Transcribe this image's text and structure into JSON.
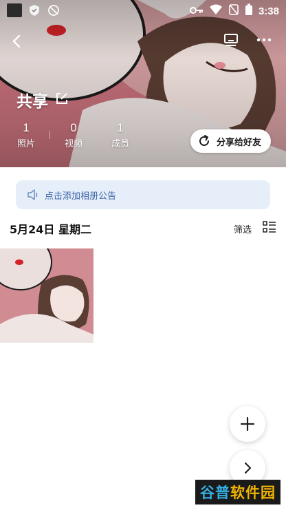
{
  "status_bar": {
    "time": "3:38",
    "icons": [
      "app-notification-icon",
      "shield-icon",
      "sync-icon",
      "key-icon",
      "wifi-icon",
      "no-sim-icon",
      "battery-icon"
    ]
  },
  "nav": {
    "back_icon": "chevron-left-icon",
    "right_icons": [
      "screen-cast-icon",
      "more-icon"
    ]
  },
  "album": {
    "name": "共享",
    "edit_icon": "edit-icon",
    "stats": [
      {
        "value": "1",
        "label": "照片"
      },
      {
        "value": "0",
        "label": "视频"
      },
      {
        "value": "1",
        "label": "成员"
      }
    ],
    "share_button": "分享给好友"
  },
  "notice": {
    "text": "点击添加相册公告",
    "icon": "speaker-icon"
  },
  "date_section": {
    "title": "5月24日 星期二",
    "filter_label": "筛选",
    "view_icon": "list-view-icon"
  },
  "fabs": {
    "add_icon": "plus-icon",
    "next_icon": "chevron-right-icon"
  },
  "watermark": {
    "part_a": "谷普",
    "part_b": "软件园"
  },
  "colors": {
    "notice_bg": "#e6eef9",
    "notice_text": "#3d68a8",
    "hero_pink": "#cf7c84"
  }
}
